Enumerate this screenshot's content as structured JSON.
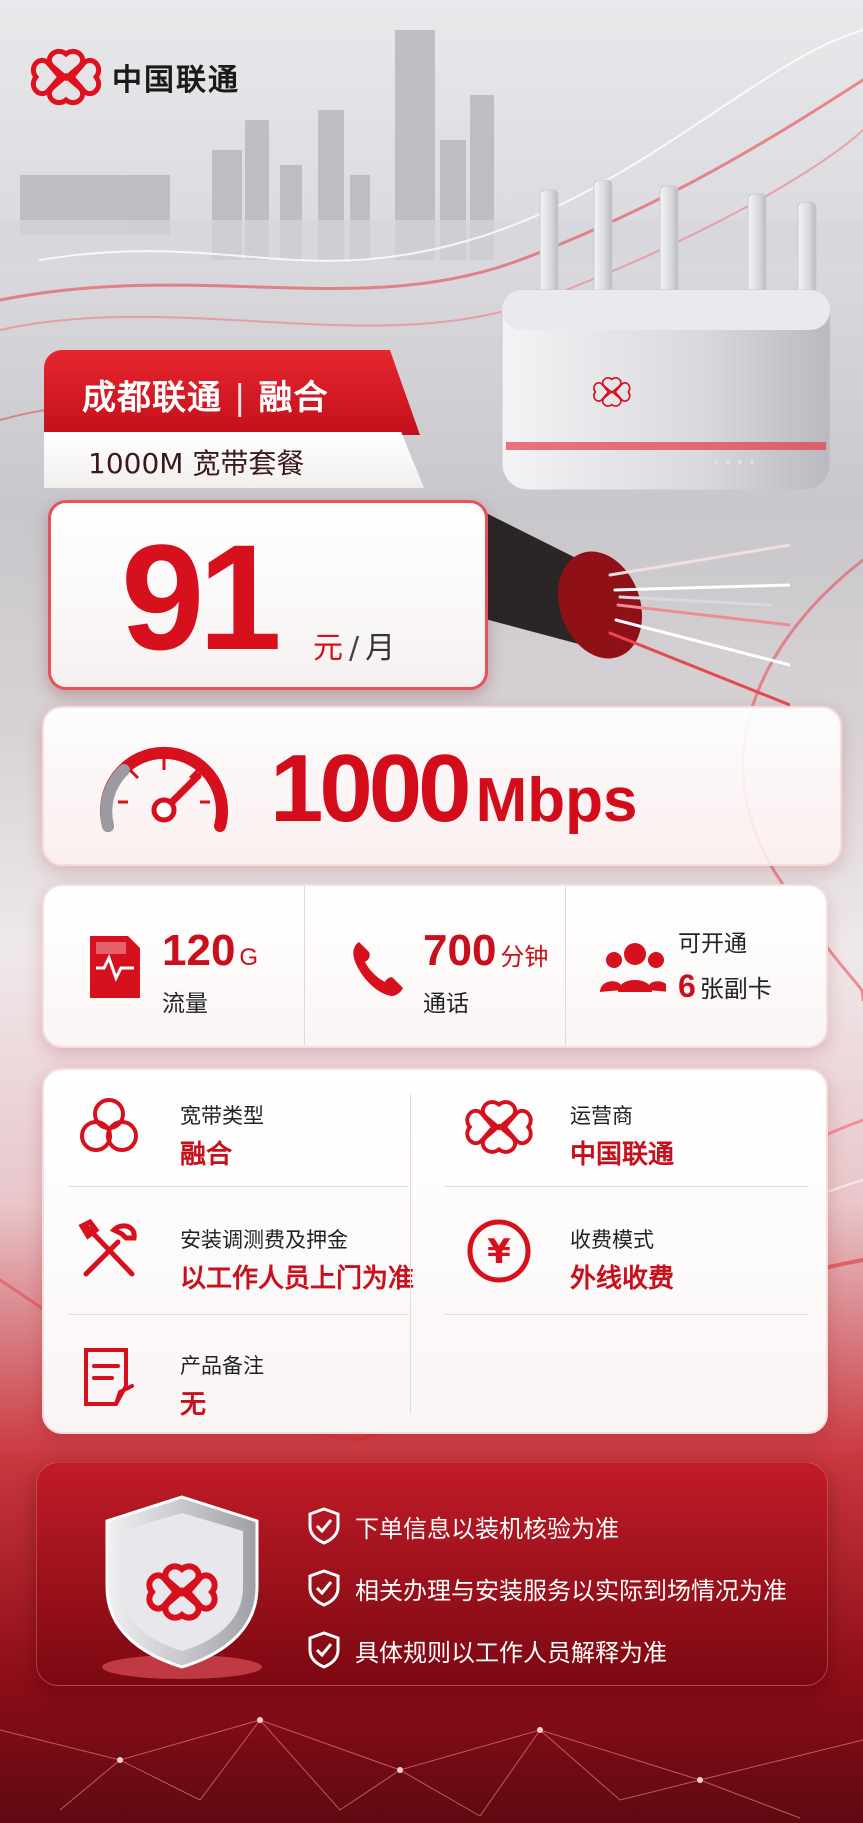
{
  "brand": {
    "name": "中国联通"
  },
  "banner": {
    "city": "成都联通",
    "separator": "|",
    "tag": "融合",
    "subtitle": "1000M 宽带套餐"
  },
  "price": {
    "amount": "91",
    "currency": "元",
    "slash": "/",
    "period": "月"
  },
  "speed": {
    "value": "1000",
    "unit": "Mbps"
  },
  "features": [
    {
      "icon": "data-card-icon",
      "value": "120",
      "unit": "G",
      "label": "流量"
    },
    {
      "icon": "phone-icon",
      "value": "700",
      "unit": "分钟",
      "label": "通话"
    },
    {
      "icon": "users-icon",
      "top": "可开通",
      "value": "6",
      "unit": "张副卡"
    }
  ],
  "info": {
    "broadband_type": {
      "label": "宽带类型",
      "value": "融合",
      "icon": "three-circles-icon"
    },
    "carrier": {
      "label": "运营商",
      "value": "中国联通",
      "icon": "unicom-knot-icon"
    },
    "install_fee": {
      "label": "安装调测费及押金",
      "value": "以工作人员上门为准",
      "icon": "tools-icon"
    },
    "billing": {
      "label": "收费模式",
      "value": "外线收费",
      "icon": "yen-coin-icon"
    },
    "remark": {
      "label": "产品备注",
      "value": "无",
      "icon": "note-edit-icon"
    }
  },
  "notes": [
    "下单信息以装机核验为准",
    "相关办理与安装服务以实际到场情况为准",
    "具体规则以工作人员解释为准"
  ],
  "colors": {
    "brand_red": "#d6101d",
    "dark_red": "#8d0d18"
  }
}
